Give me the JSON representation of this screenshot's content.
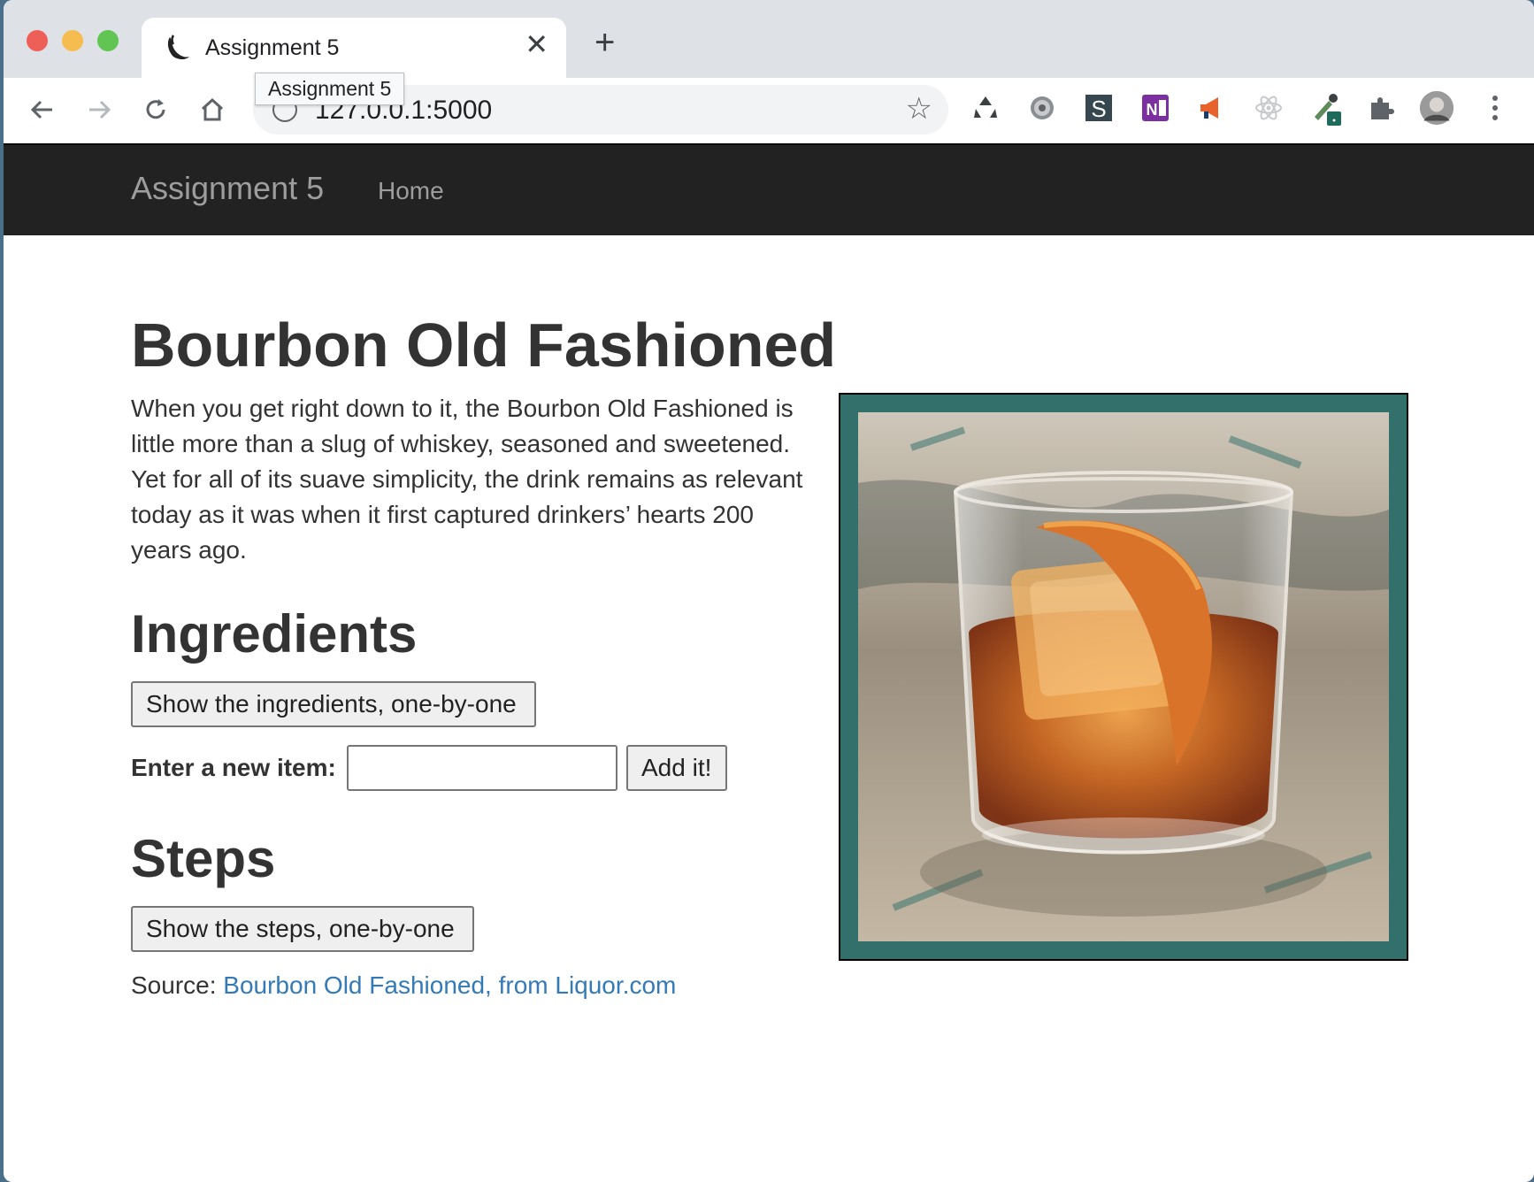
{
  "browser": {
    "tab_title": "Assignment 5",
    "tooltip": "Assignment 5",
    "url": "127.0.0.1:5000"
  },
  "navbar": {
    "brand": "Assignment 5",
    "home": "Home"
  },
  "recipe": {
    "title": "Bourbon Old Fashioned",
    "description": "When you get right down to it, the Bourbon Old Fashioned is little more than a slug of whiskey, seasoned and sweetened. Yet for all of its suave simplicity, the drink remains as relevant today as it was when it first captured drinkers’ hearts 200 years ago.",
    "ingredients_heading": "Ingredients",
    "show_ingredients_button": "Show the ingredients, one-by-one",
    "new_item_label": "Enter a new item:",
    "new_item_value": "",
    "add_button": "Add it!",
    "steps_heading": "Steps",
    "show_steps_button": "Show the steps, one-by-one",
    "source_label": "Source: ",
    "source_link": "Bourbon Old Fashioned, from Liquor.com"
  },
  "colors": {
    "navbar_bg": "#222222",
    "image_frame": "#336f6b",
    "link": "#337ab7"
  }
}
